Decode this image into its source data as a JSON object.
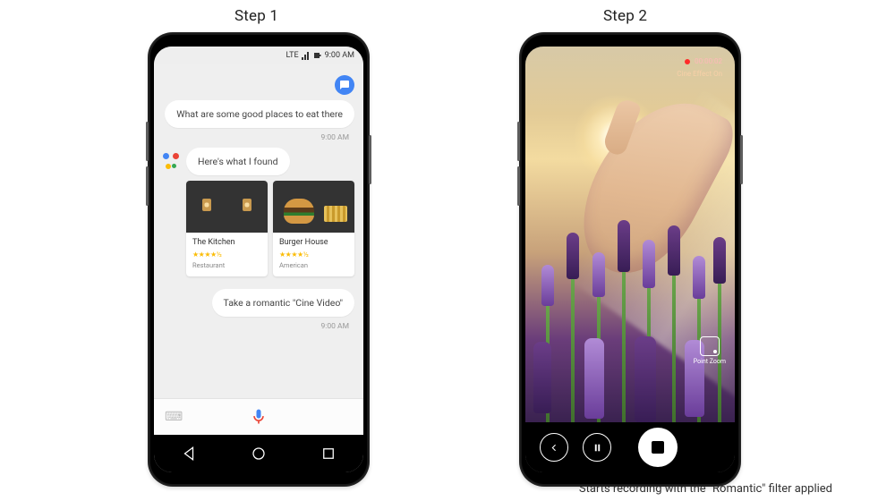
{
  "labels": {
    "step1": "Step 1",
    "step2": "Step 2"
  },
  "caption_right": "Starts recording with the \"Romantic\" filter applied",
  "phone_left": {
    "status": {
      "time": "9:00 AM",
      "carrier": "LTE"
    },
    "conversation": {
      "user_msg_1": "What are some good places to eat there",
      "ts_1": "9:00 AM",
      "assistant_reply": "Here's what I found",
      "cards": [
        {
          "title": "The Kitchen",
          "rating": "★★★★½",
          "category": "Restaurant"
        },
        {
          "title": "Burger House",
          "rating": "★★★★½",
          "category": "American"
        }
      ],
      "user_msg_2": "Take a romantic \"Cine Video\"",
      "ts_2": "9:00 AM"
    },
    "nav": {
      "back": "Back",
      "home": "Home",
      "recent": "Recent"
    }
  },
  "phone_right": {
    "recording": {
      "time": "00:00:02",
      "effect_label": "Cine Effect On"
    },
    "point_zoom": "Point Zoom",
    "controls": {
      "back": "Back",
      "pause": "Pause",
      "stop": "Stop"
    }
  }
}
